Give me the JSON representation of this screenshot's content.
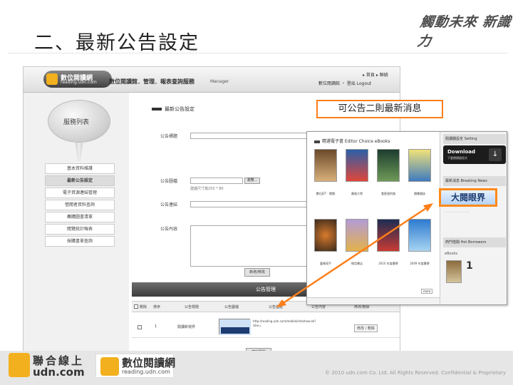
{
  "slide": {
    "title": "二、最新公告設定",
    "slogan": "觸動未來 新識力",
    "callout": "可公告二則最新消息",
    "copyright": "© 2010 udn.com Co. Ltd. All Rights Reserved. Confidential & Proprietary"
  },
  "screenshot": {
    "logo_name": "數位閱讀網",
    "logo_url": "reading.udn.com",
    "header_title": "數位閱讀館．管理．報表查詢服務",
    "header_sub": "Manager",
    "header_links_1": "▸ 首頁 ▸ 聯絡",
    "header_links_2": "數位閱讀館 ・ 登出 Logout",
    "sidebar_title": "服務列表",
    "menu": [
      "基本資料維護",
      "最新公告設定",
      "電子資源連結管理",
      "借閱者資料查詢",
      "薦購圖書清單",
      "閱覽統計報表",
      "採購書單查詢"
    ],
    "section_title": "最新公告設定",
    "form": {
      "title_label": "公告標題",
      "image_label": "公告圖檔",
      "link_label": "公告連結",
      "content_label": "公告內容",
      "upload_label": "瀏覽...",
      "image_hint": "建議尺寸寬250 * 80",
      "action_label": "新增/修改"
    },
    "table": {
      "title": "公告管理",
      "headers": [
        "刪除",
        "排序",
        "公告標題",
        "公告圖檔",
        "公告連結",
        "公告內容",
        "修改/刪除"
      ],
      "rows": [
        {
          "order": "1",
          "title": "閱讀新視界",
          "link": "http://reading.udn.com/mobile/infoshow.do?isbn=",
          "content": "",
          "action": "修改 / 刪除"
        }
      ],
      "delete_label": "確定刪除"
    }
  },
  "overlay": {
    "header": "精選電子書 Editor Choice eBooks",
    "books": [
      {
        "title": "數位JET - 閱讀"
      },
      {
        "title": "最後大將"
      },
      {
        "title": "看更遠的路"
      },
      {
        "title": "讀書雜誌"
      },
      {
        "title": "靈感寫手"
      },
      {
        "title": "微型書店"
      },
      {
        "title": "2010 年度書單"
      },
      {
        "title": "2009 年度書單"
      }
    ],
    "more_label": "more",
    "side": {
      "settings_title": "閱讀器設定 Setting",
      "download_title": "Download",
      "download_sub": "下載閱讀器程式",
      "download_icon": "↓",
      "news_title": "最新消息 Breaking News",
      "big_eye": "大閱眼界",
      "popular_title": "熱門借閱 Hot Borrowers",
      "ebooks_label": "eBooks",
      "rank": "1"
    }
  },
  "footer": {
    "udn_name": "聯合線上",
    "udn_domain": "udn.com",
    "reading_name": "數位閱讀網",
    "reading_domain": "reading.udn.com"
  },
  "colors": {
    "accent": "#ff7f1a",
    "header_dark": "#3c3c3c",
    "logo_yellow": "#f2b01e"
  }
}
